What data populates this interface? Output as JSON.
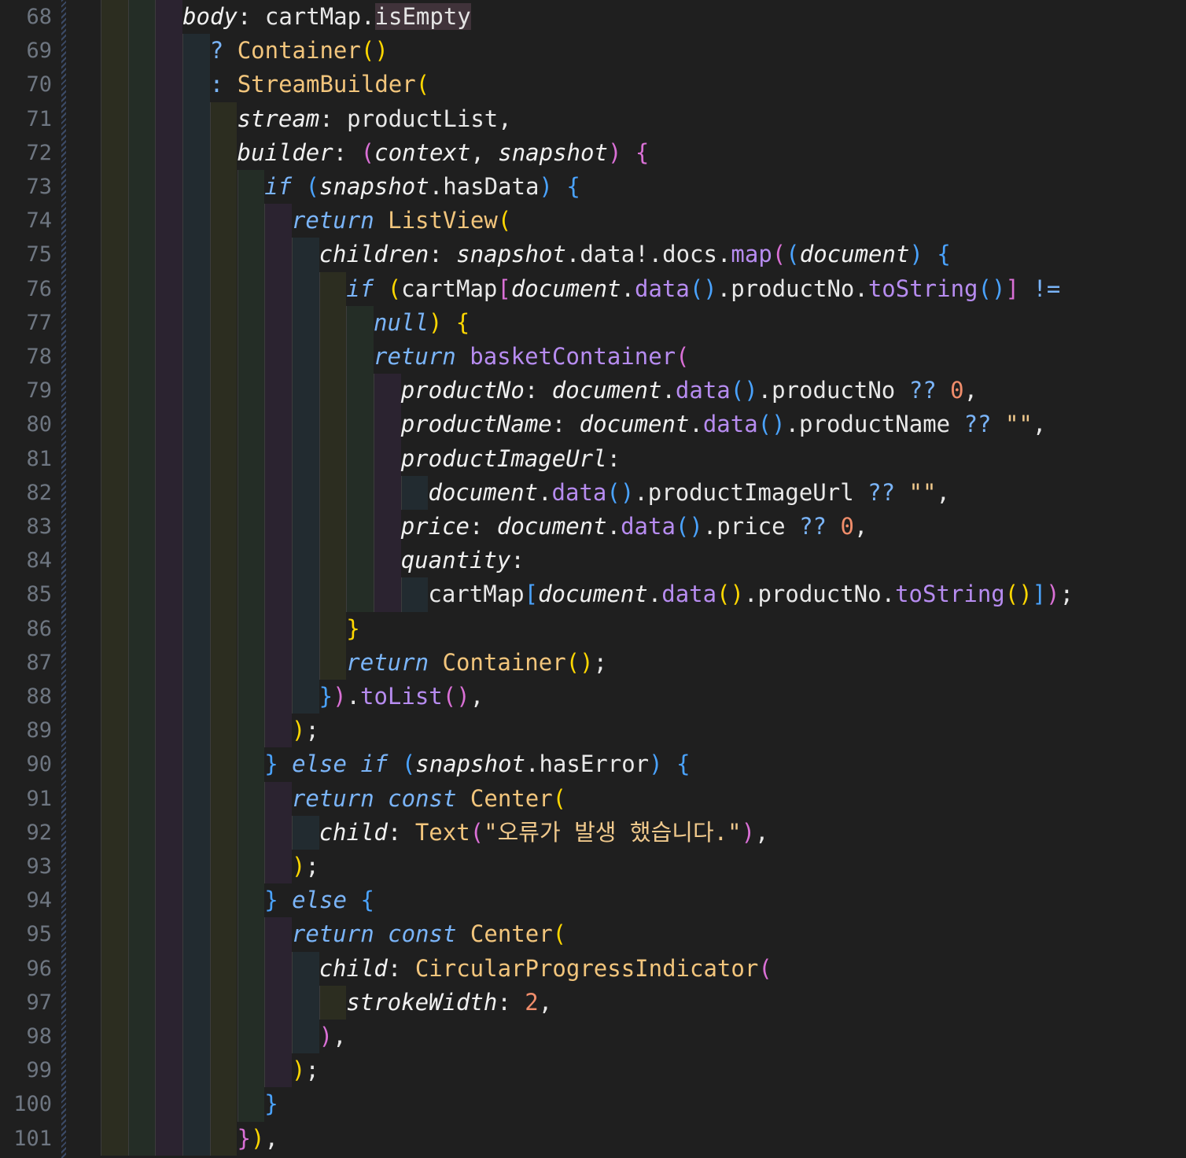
{
  "editor": {
    "language": "dart",
    "first_line_number": 68,
    "colors": {
      "background": "#1f1f1f",
      "keyword": "#7ab4f8",
      "class": "#f2c57c",
      "method": "#b78cf0",
      "number": "#f08d6b",
      "line_number": "#6e7681"
    },
    "lines": [
      {
        "n": "68",
        "indent": 6,
        "tokens": [
          [
            "param",
            "body"
          ],
          [
            "plain",
            ": cartMap."
          ],
          [
            "hl",
            "isEmpty"
          ]
        ]
      },
      {
        "n": "69",
        "indent": 8,
        "tokens": [
          [
            "op",
            "? "
          ],
          [
            "cls",
            "Container"
          ],
          [
            "b1",
            "()"
          ]
        ]
      },
      {
        "n": "70",
        "indent": 8,
        "tokens": [
          [
            "op",
            ": "
          ],
          [
            "cls",
            "StreamBuilder"
          ],
          [
            "b1",
            "("
          ]
        ]
      },
      {
        "n": "71",
        "indent": 10,
        "tokens": [
          [
            "param",
            "stream"
          ],
          [
            "plain",
            ": productList,"
          ]
        ]
      },
      {
        "n": "72",
        "indent": 10,
        "tokens": [
          [
            "param",
            "builder"
          ],
          [
            "plain",
            ": "
          ],
          [
            "b2",
            "("
          ],
          [
            "param",
            "context"
          ],
          [
            "plain",
            ", "
          ],
          [
            "param",
            "snapshot"
          ],
          [
            "b2",
            ")"
          ],
          [
            "plain",
            " "
          ],
          [
            "b2",
            "{"
          ]
        ]
      },
      {
        "n": "73",
        "indent": 12,
        "tokens": [
          [
            "kw",
            "if"
          ],
          [
            "plain",
            " "
          ],
          [
            "b3",
            "("
          ],
          [
            "param",
            "snapshot"
          ],
          [
            "plain",
            ".hasData"
          ],
          [
            "b3",
            ")"
          ],
          [
            "plain",
            " "
          ],
          [
            "b3",
            "{"
          ]
        ]
      },
      {
        "n": "74",
        "indent": 14,
        "tokens": [
          [
            "kw",
            "return"
          ],
          [
            "plain",
            " "
          ],
          [
            "cls",
            "ListView"
          ],
          [
            "b1",
            "("
          ]
        ]
      },
      {
        "n": "75",
        "indent": 16,
        "tokens": [
          [
            "param",
            "children"
          ],
          [
            "plain",
            ": "
          ],
          [
            "param",
            "snapshot"
          ],
          [
            "plain",
            ".data!.docs."
          ],
          [
            "fn",
            "map"
          ],
          [
            "b2",
            "("
          ],
          [
            "b3",
            "("
          ],
          [
            "param",
            "document"
          ],
          [
            "b3",
            ")"
          ],
          [
            "plain",
            " "
          ],
          [
            "b3",
            "{"
          ]
        ]
      },
      {
        "n": "76",
        "indent": 18,
        "tokens": [
          [
            "kw",
            "if"
          ],
          [
            "plain",
            " "
          ],
          [
            "b1",
            "("
          ],
          [
            "plain",
            "cartMap"
          ],
          [
            "b2",
            "["
          ],
          [
            "param",
            "document"
          ],
          [
            "plain",
            "."
          ],
          [
            "fn",
            "data"
          ],
          [
            "b3",
            "()"
          ],
          [
            "plain",
            ".productNo."
          ],
          [
            "fn",
            "toString"
          ],
          [
            "b3",
            "()"
          ],
          [
            "b2",
            "]"
          ],
          [
            "plain",
            " "
          ],
          [
            "op",
            "!="
          ]
        ]
      },
      {
        "n": "77",
        "indent": 20,
        "tokens": [
          [
            "kw",
            "null"
          ],
          [
            "b1",
            ")"
          ],
          [
            "plain",
            " "
          ],
          [
            "b1",
            "{"
          ]
        ]
      },
      {
        "n": "78",
        "indent": 20,
        "tokens": [
          [
            "kw",
            "return"
          ],
          [
            "plain",
            " "
          ],
          [
            "fn",
            "basketContainer"
          ],
          [
            "b2",
            "("
          ]
        ]
      },
      {
        "n": "79",
        "indent": 22,
        "tokens": [
          [
            "param",
            "productNo"
          ],
          [
            "plain",
            ": "
          ],
          [
            "param",
            "document"
          ],
          [
            "plain",
            "."
          ],
          [
            "fn",
            "data"
          ],
          [
            "b3",
            "()"
          ],
          [
            "plain",
            ".productNo "
          ],
          [
            "op",
            "??"
          ],
          [
            "plain",
            " "
          ],
          [
            "num",
            "0"
          ],
          [
            "plain",
            ","
          ]
        ]
      },
      {
        "n": "80",
        "indent": 22,
        "tokens": [
          [
            "param",
            "productName"
          ],
          [
            "plain",
            ": "
          ],
          [
            "param",
            "document"
          ],
          [
            "plain",
            "."
          ],
          [
            "fn",
            "data"
          ],
          [
            "b3",
            "()"
          ],
          [
            "plain",
            ".productName "
          ],
          [
            "op",
            "??"
          ],
          [
            "plain",
            " "
          ],
          [
            "str",
            "\"\""
          ],
          [
            "plain",
            ","
          ]
        ]
      },
      {
        "n": "81",
        "indent": 22,
        "tokens": [
          [
            "param",
            "productImageUrl"
          ],
          [
            "plain",
            ":"
          ]
        ]
      },
      {
        "n": "82",
        "indent": 24,
        "tokens": [
          [
            "param",
            "document"
          ],
          [
            "plain",
            "."
          ],
          [
            "fn",
            "data"
          ],
          [
            "b3",
            "()"
          ],
          [
            "plain",
            ".productImageUrl "
          ],
          [
            "op",
            "??"
          ],
          [
            "plain",
            " "
          ],
          [
            "str",
            "\"\""
          ],
          [
            "plain",
            ","
          ]
        ]
      },
      {
        "n": "83",
        "indent": 22,
        "tokens": [
          [
            "param",
            "price"
          ],
          [
            "plain",
            ": "
          ],
          [
            "param",
            "document"
          ],
          [
            "plain",
            "."
          ],
          [
            "fn",
            "data"
          ],
          [
            "b3",
            "()"
          ],
          [
            "plain",
            ".price "
          ],
          [
            "op",
            "??"
          ],
          [
            "plain",
            " "
          ],
          [
            "num",
            "0"
          ],
          [
            "plain",
            ","
          ]
        ]
      },
      {
        "n": "84",
        "indent": 22,
        "tokens": [
          [
            "param",
            "quantity"
          ],
          [
            "plain",
            ":"
          ]
        ]
      },
      {
        "n": "85",
        "indent": 24,
        "tokens": [
          [
            "plain",
            "cartMap"
          ],
          [
            "b3",
            "["
          ],
          [
            "param",
            "document"
          ],
          [
            "plain",
            "."
          ],
          [
            "fn",
            "data"
          ],
          [
            "b1",
            "()"
          ],
          [
            "plain",
            ".productNo."
          ],
          [
            "fn",
            "toString"
          ],
          [
            "b1",
            "()"
          ],
          [
            "b3",
            "]"
          ],
          [
            "b2",
            ")"
          ],
          [
            "plain",
            ";"
          ]
        ]
      },
      {
        "n": "86",
        "indent": 18,
        "tokens": [
          [
            "b1",
            "}"
          ]
        ]
      },
      {
        "n": "87",
        "indent": 18,
        "tokens": [
          [
            "kw",
            "return"
          ],
          [
            "plain",
            " "
          ],
          [
            "cls",
            "Container"
          ],
          [
            "b1",
            "()"
          ],
          [
            "plain",
            ";"
          ]
        ]
      },
      {
        "n": "88",
        "indent": 16,
        "tokens": [
          [
            "b3",
            "}"
          ],
          [
            "b2",
            ")"
          ],
          [
            "plain",
            "."
          ],
          [
            "fn",
            "toList"
          ],
          [
            "b2",
            "()"
          ],
          [
            "plain",
            ","
          ]
        ]
      },
      {
        "n": "89",
        "indent": 14,
        "tokens": [
          [
            "b1",
            ")"
          ],
          [
            "plain",
            ";"
          ]
        ]
      },
      {
        "n": "90",
        "indent": 12,
        "tokens": [
          [
            "b3",
            "}"
          ],
          [
            "plain",
            " "
          ],
          [
            "kw",
            "else"
          ],
          [
            "plain",
            " "
          ],
          [
            "kw",
            "if"
          ],
          [
            "plain",
            " "
          ],
          [
            "b3",
            "("
          ],
          [
            "param",
            "snapshot"
          ],
          [
            "plain",
            ".hasError"
          ],
          [
            "b3",
            ")"
          ],
          [
            "plain",
            " "
          ],
          [
            "b3",
            "{"
          ]
        ]
      },
      {
        "n": "91",
        "indent": 14,
        "tokens": [
          [
            "kw",
            "return"
          ],
          [
            "plain",
            " "
          ],
          [
            "kw",
            "const"
          ],
          [
            "plain",
            " "
          ],
          [
            "cls",
            "Center"
          ],
          [
            "b1",
            "("
          ]
        ]
      },
      {
        "n": "92",
        "indent": 16,
        "tokens": [
          [
            "param",
            "child"
          ],
          [
            "plain",
            ": "
          ],
          [
            "cls",
            "Text"
          ],
          [
            "b2",
            "("
          ],
          [
            "str",
            "\"오류가 발생 했습니다.\""
          ],
          [
            "b2",
            ")"
          ],
          [
            "plain",
            ","
          ]
        ]
      },
      {
        "n": "93",
        "indent": 14,
        "tokens": [
          [
            "b1",
            ")"
          ],
          [
            "plain",
            ";"
          ]
        ]
      },
      {
        "n": "94",
        "indent": 12,
        "tokens": [
          [
            "b3",
            "}"
          ],
          [
            "plain",
            " "
          ],
          [
            "kw",
            "else"
          ],
          [
            "plain",
            " "
          ],
          [
            "b3",
            "{"
          ]
        ]
      },
      {
        "n": "95",
        "indent": 14,
        "tokens": [
          [
            "kw",
            "return"
          ],
          [
            "plain",
            " "
          ],
          [
            "kw",
            "const"
          ],
          [
            "plain",
            " "
          ],
          [
            "cls",
            "Center"
          ],
          [
            "b1",
            "("
          ]
        ]
      },
      {
        "n": "96",
        "indent": 16,
        "tokens": [
          [
            "param",
            "child"
          ],
          [
            "plain",
            ": "
          ],
          [
            "cls",
            "CircularProgressIndicator"
          ],
          [
            "b2",
            "("
          ]
        ]
      },
      {
        "n": "97",
        "indent": 18,
        "tokens": [
          [
            "param",
            "strokeWidth"
          ],
          [
            "plain",
            ": "
          ],
          [
            "num",
            "2"
          ],
          [
            "plain",
            ","
          ]
        ]
      },
      {
        "n": "98",
        "indent": 16,
        "tokens": [
          [
            "b2",
            ")"
          ],
          [
            "plain",
            ","
          ]
        ]
      },
      {
        "n": "99",
        "indent": 14,
        "tokens": [
          [
            "b1",
            ")"
          ],
          [
            "plain",
            ";"
          ]
        ]
      },
      {
        "n": "100",
        "indent": 12,
        "tokens": [
          [
            "b3",
            "}"
          ]
        ]
      },
      {
        "n": "101",
        "indent": 10,
        "tokens": [
          [
            "b2",
            "}"
          ],
          [
            "b1",
            ")"
          ],
          [
            "plain",
            ","
          ]
        ]
      }
    ]
  }
}
